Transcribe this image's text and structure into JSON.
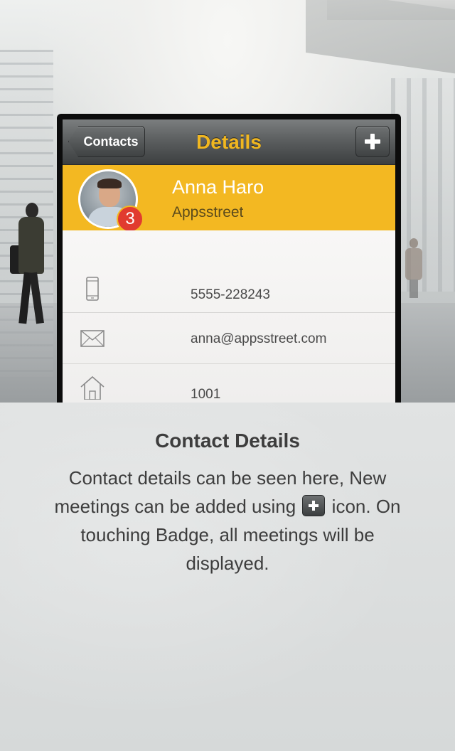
{
  "navbar": {
    "back_label": "Contacts",
    "title": "Details",
    "add_icon": "plus-icon"
  },
  "contact": {
    "name": "Anna Haro",
    "company": "Appsstreet",
    "badge_count": "3",
    "phone": "5555-228243",
    "email": "anna@appsstreet.com",
    "address": "1001"
  },
  "icons": {
    "phone": "mobile-phone-icon",
    "email": "envelope-icon",
    "address": "house-icon"
  },
  "colors": {
    "accent_yellow": "#f3b822",
    "title_yellow": "#f1b720",
    "badge_red": "#e13b2f",
    "navbar_gray": "#4c4f50"
  },
  "caption": {
    "title": "Contact Details",
    "line1": "Contact details can be seen here, New meetings can be added using",
    "line1_end": "icon. On touching Badge, all meetings will be displayed."
  }
}
